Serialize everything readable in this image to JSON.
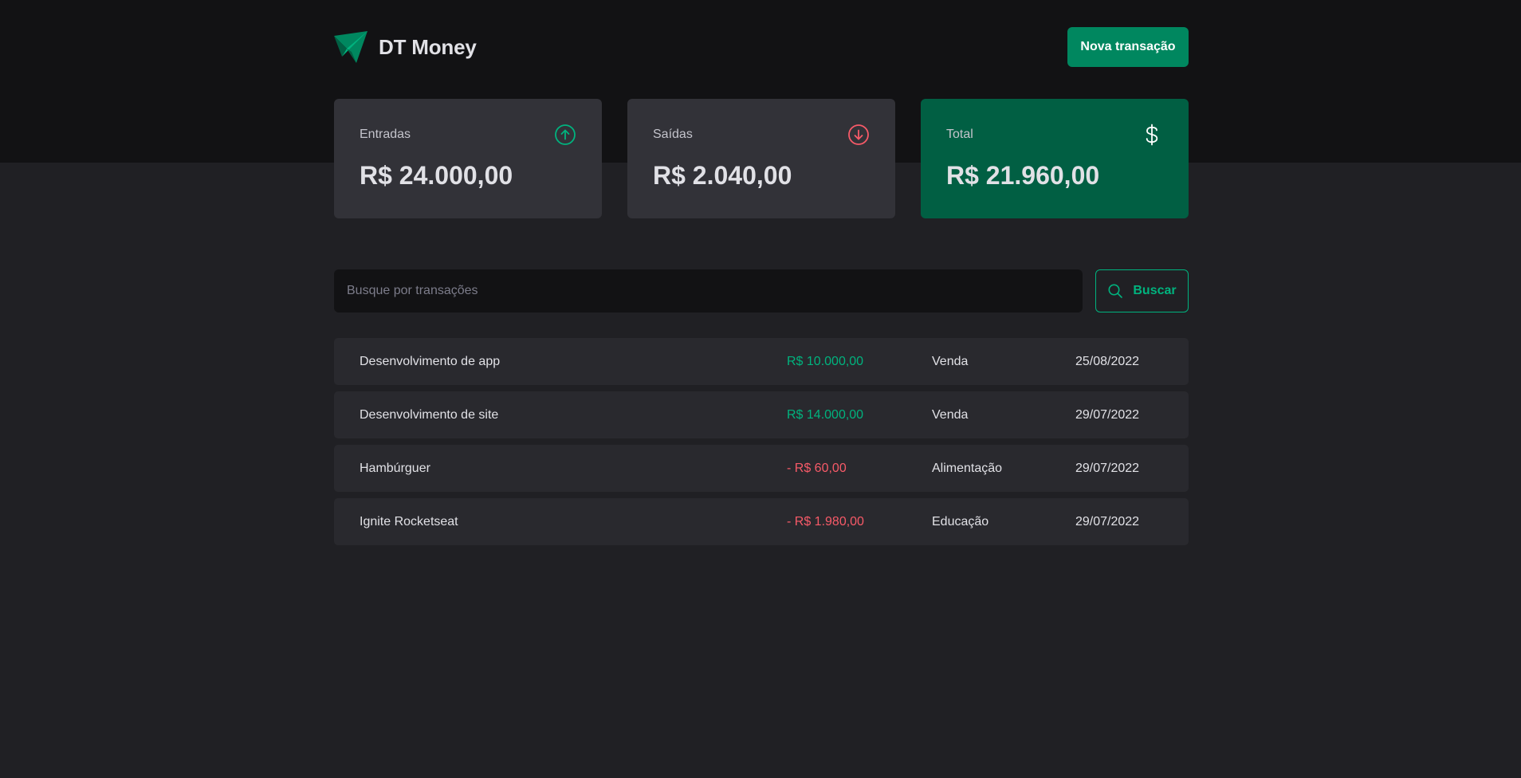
{
  "app": {
    "name": "DT Money",
    "logo_icon": "paper-plane-logo-icon",
    "accent_color": "#00875f",
    "accent_light": "#00b37e",
    "danger_color": "#f75a68"
  },
  "header": {
    "new_transaction_label": "Nova transação"
  },
  "summary": {
    "income": {
      "label": "Entradas",
      "value": "R$ 24.000,00",
      "icon": "arrow-circle-up-icon"
    },
    "outcome": {
      "label": "Saídas",
      "value": "R$ 2.040,00",
      "icon": "arrow-circle-down-icon"
    },
    "total": {
      "label": "Total",
      "value": "R$ 21.960,00",
      "icon": "dollar-icon"
    }
  },
  "search": {
    "placeholder": "Busque por transações",
    "button_label": "Buscar",
    "icon": "search-icon"
  },
  "transactions": [
    {
      "description": "Desenvolvimento de app",
      "price": "R$ 10.000,00",
      "type": "income",
      "category": "Venda",
      "date": "25/08/2022"
    },
    {
      "description": "Desenvolvimento de site",
      "price": "R$ 14.000,00",
      "type": "income",
      "category": "Venda",
      "date": "29/07/2022"
    },
    {
      "description": "Hambúrguer",
      "price": "- R$ 60,00",
      "type": "outcome",
      "category": "Alimentação",
      "date": "29/07/2022"
    },
    {
      "description": "Ignite Rocketseat",
      "price": "- R$ 1.980,00",
      "type": "outcome",
      "category": "Educação",
      "date": "29/07/2022"
    }
  ]
}
